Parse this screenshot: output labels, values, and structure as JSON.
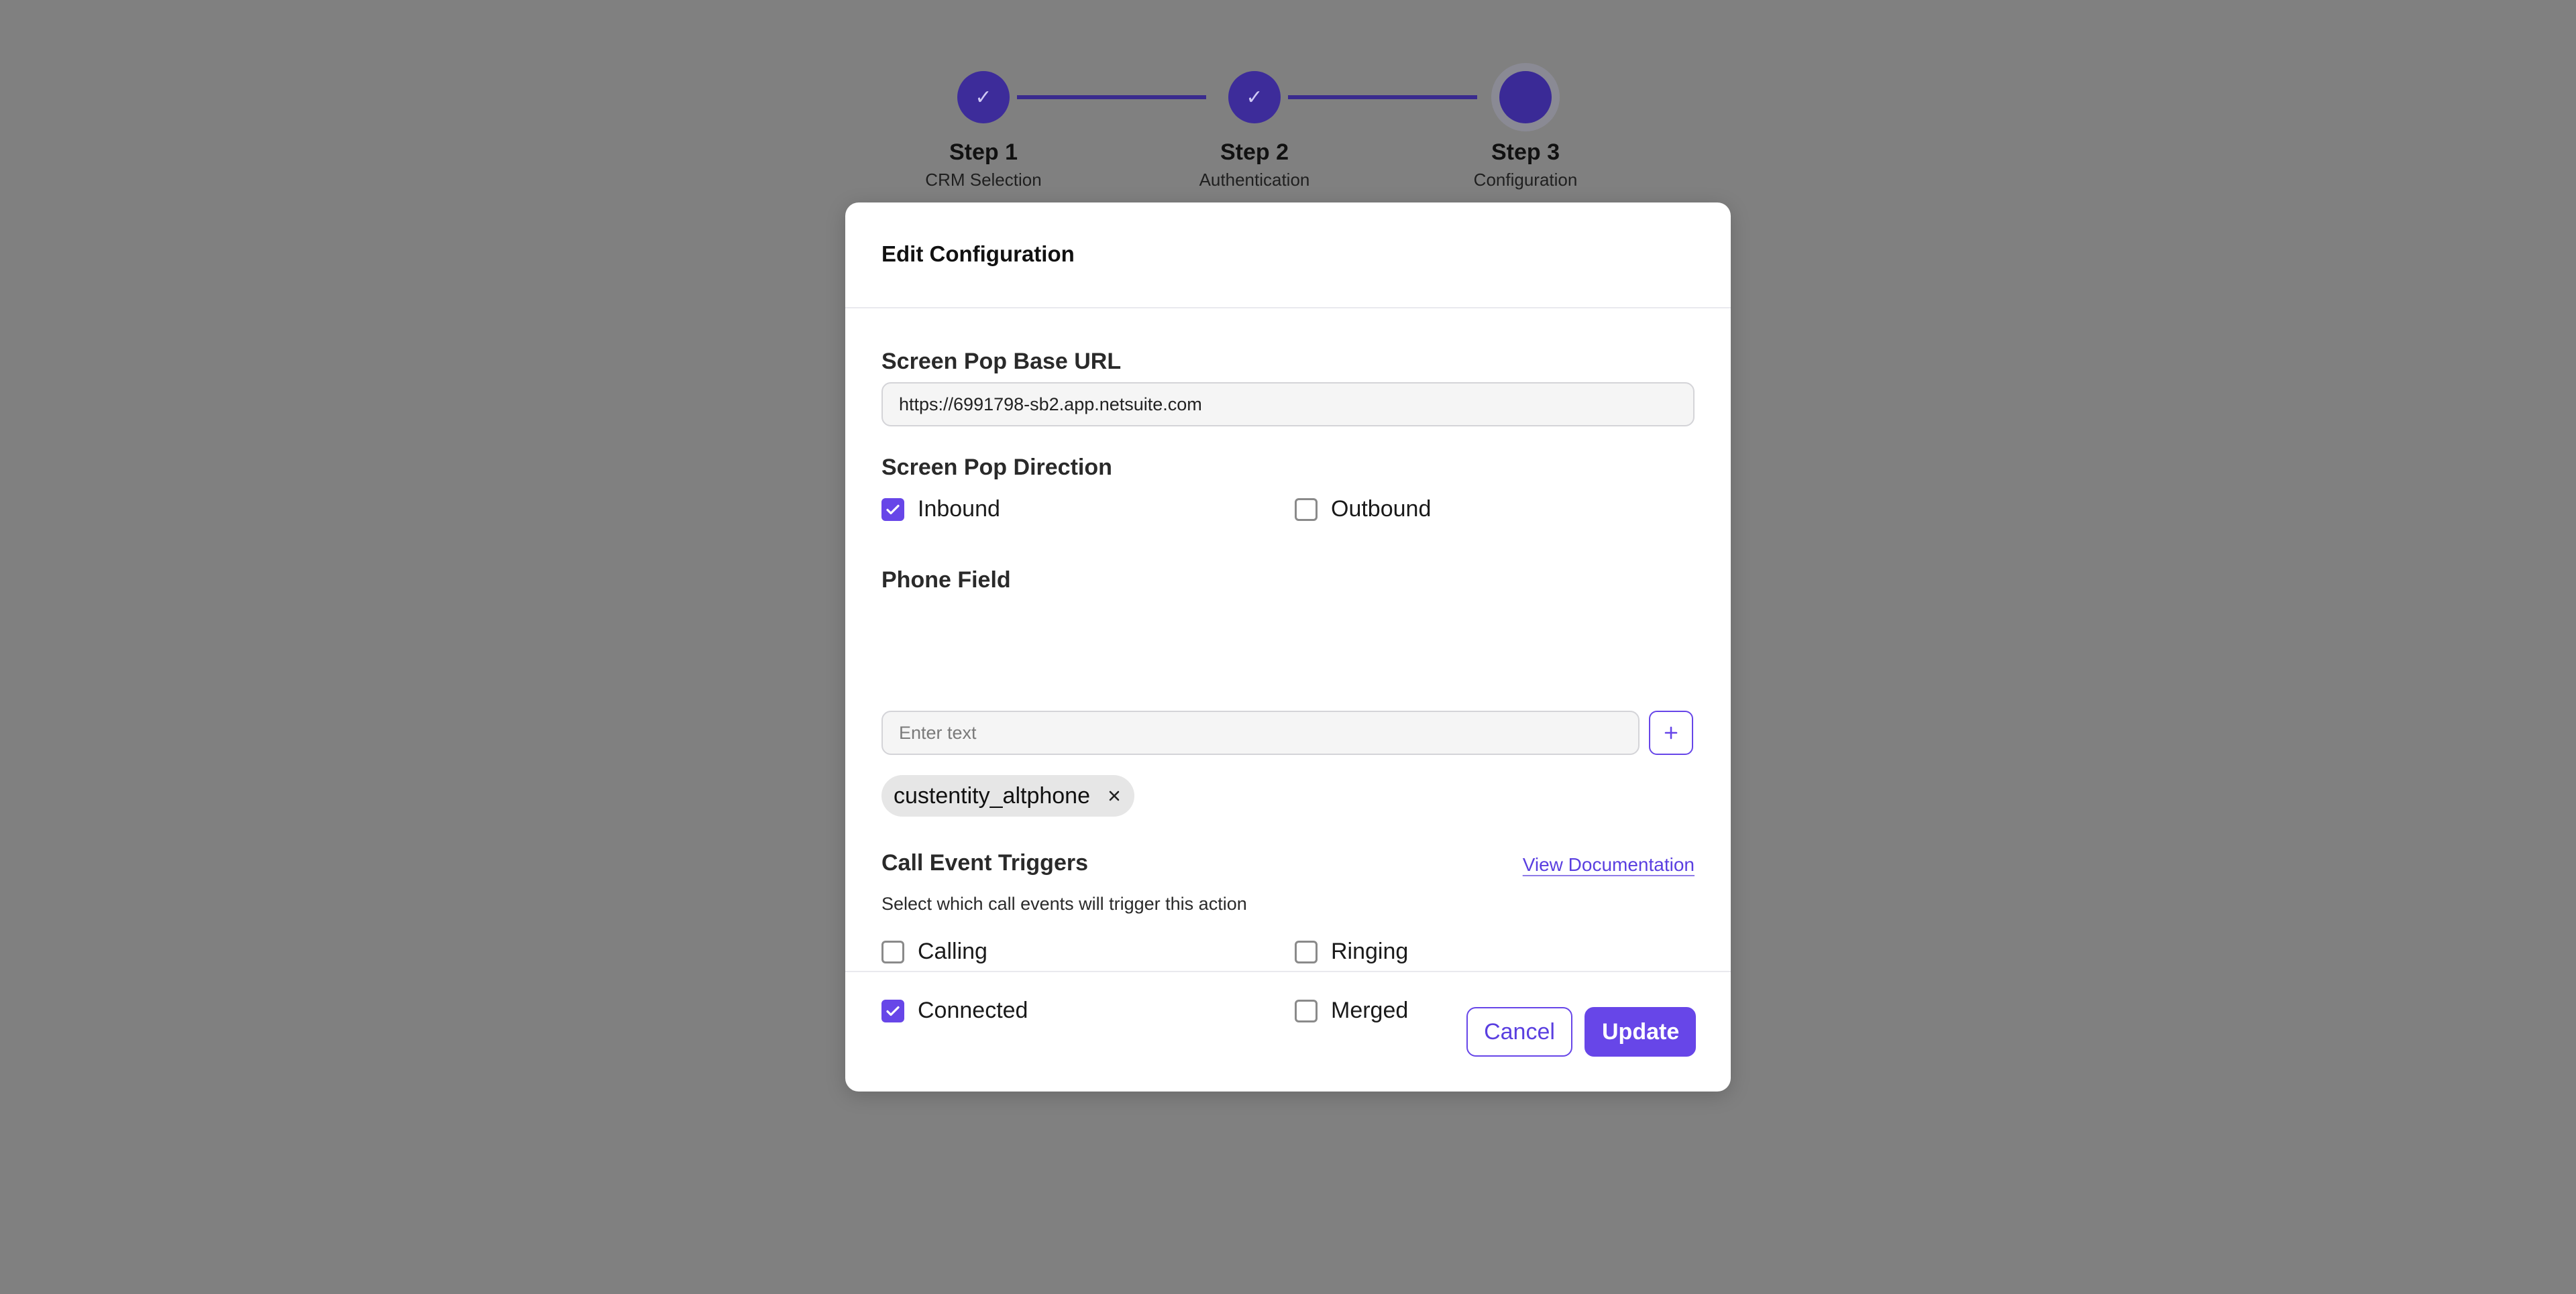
{
  "stepper": {
    "steps": [
      {
        "title": "Step 1",
        "subtitle": "CRM Selection",
        "status": "complete"
      },
      {
        "title": "Step 2",
        "subtitle": "Authentication",
        "status": "complete"
      },
      {
        "title": "Step 3",
        "subtitle": "Configuration",
        "status": "current"
      }
    ],
    "check_glyph": "✓"
  },
  "modal": {
    "title": "Edit Configuration",
    "base_url": {
      "label": "Screen Pop Base URL",
      "value": "https://6991798-sb2.app.netsuite.com"
    },
    "direction": {
      "label": "Screen Pop Direction",
      "options": [
        {
          "label": "Inbound",
          "checked": true
        },
        {
          "label": "Outbound",
          "checked": false
        }
      ]
    },
    "phone_field": {
      "label": "Phone Field",
      "placeholder": "Enter text",
      "value": "",
      "tags": [
        "custentity_altphone"
      ]
    },
    "triggers": {
      "label": "Call Event Triggers",
      "doc_link": "View Documentation",
      "help": "Select which call events will trigger this action",
      "options": [
        {
          "label": "Calling",
          "checked": false
        },
        {
          "label": "Ringing",
          "checked": false
        },
        {
          "label": "Connected",
          "checked": true
        },
        {
          "label": "Merged",
          "checked": false
        }
      ]
    },
    "buttons": {
      "cancel": "Cancel",
      "update": "Update"
    }
  },
  "colors": {
    "accent": "#6746e8",
    "step_complete": "#3d2c9a",
    "overlay": "#808080"
  }
}
